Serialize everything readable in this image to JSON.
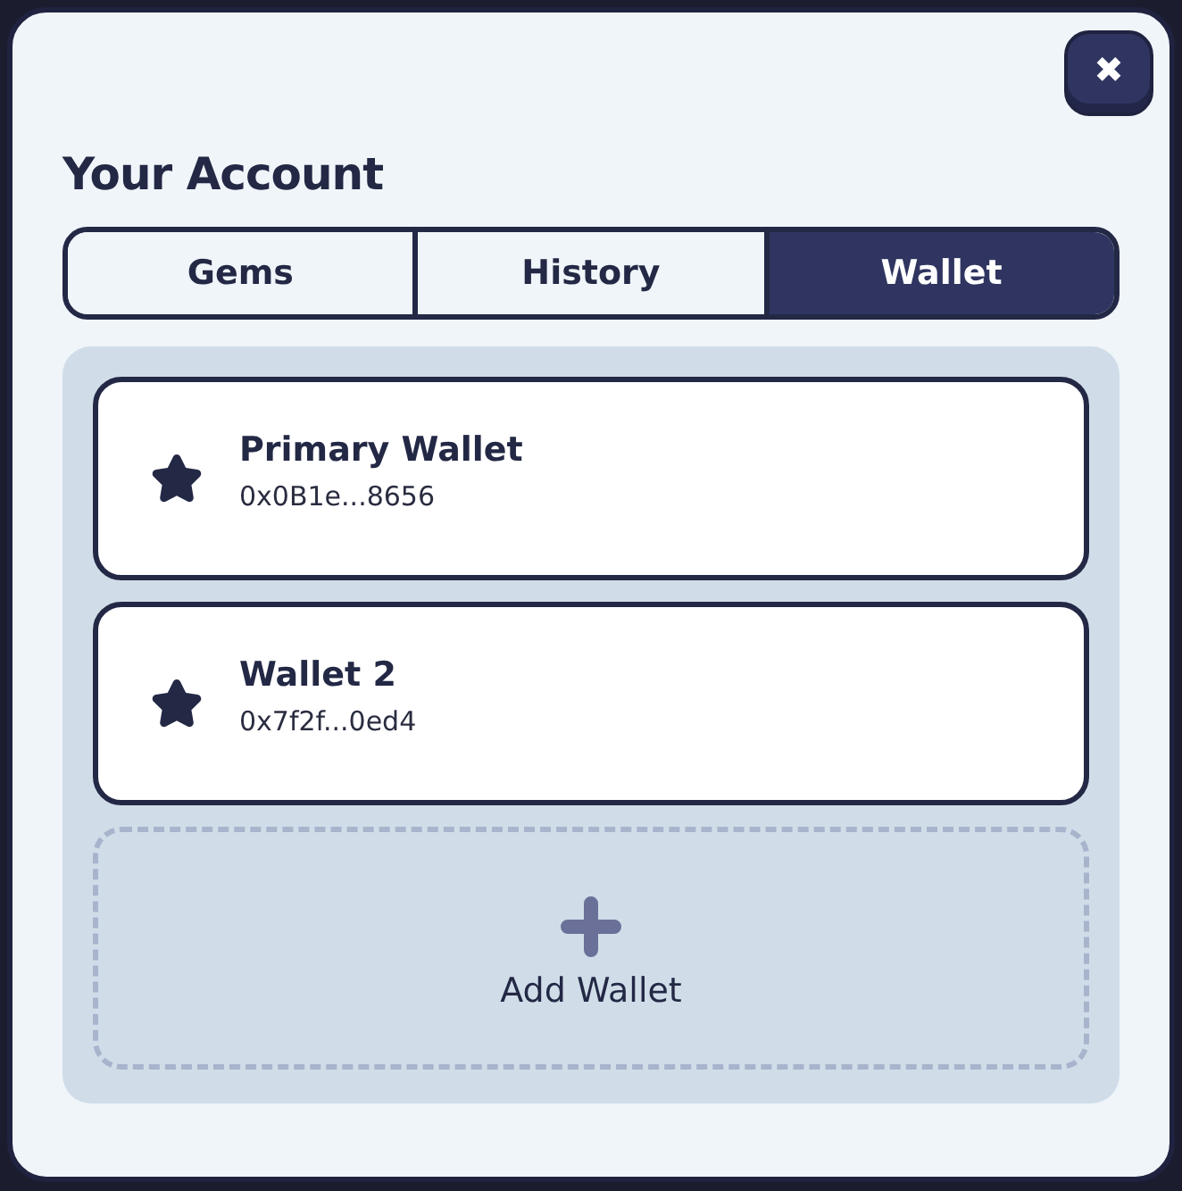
{
  "close_button": {
    "label": "✖"
  },
  "title": "Your Account",
  "tabs": [
    {
      "label": "Gems",
      "selected": false
    },
    {
      "label": "History",
      "selected": false
    },
    {
      "label": "Wallet",
      "selected": true
    }
  ],
  "wallets": [
    {
      "name": "Primary Wallet",
      "address": "0x0B1e...8656"
    },
    {
      "name": "Wallet 2",
      "address": "0x7f2f...0ed4"
    }
  ],
  "add_wallet": {
    "label": "Add Wallet"
  }
}
